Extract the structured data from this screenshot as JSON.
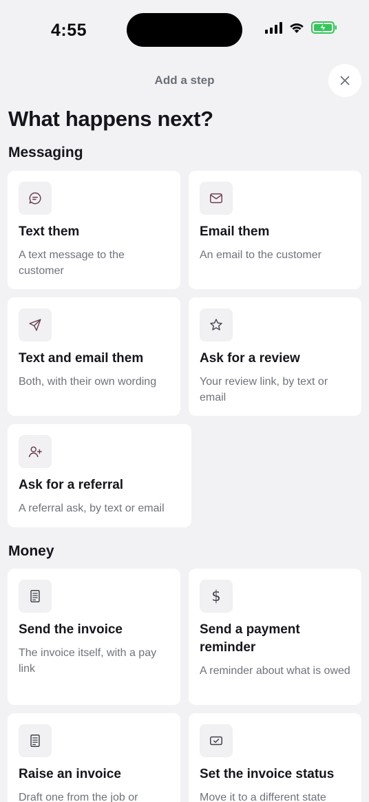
{
  "status_bar": {
    "time": "4:55"
  },
  "header": {
    "title": "Add a step"
  },
  "page": {
    "title": "What happens next?"
  },
  "sections": {
    "messaging": {
      "title": "Messaging",
      "cards": [
        {
          "title": "Text them",
          "description": "A text message to the customer",
          "icon": "chat-bubble-icon"
        },
        {
          "title": "Email them",
          "description": "An email to the customer",
          "icon": "envelope-icon"
        },
        {
          "title": "Text and email them",
          "description": "Both, with their own wording",
          "icon": "send-icon"
        },
        {
          "title": "Ask for a review",
          "description": "Your review link, by text or email",
          "icon": "star-icon"
        },
        {
          "title": "Ask for a referral",
          "description": "A referral ask, by text or email",
          "icon": "add-user-icon"
        }
      ]
    },
    "money": {
      "title": "Money",
      "cards": [
        {
          "title": "Send the invoice",
          "description": "The invoice itself, with a pay link",
          "icon": "receipt-icon"
        },
        {
          "title": "Send a payment reminder",
          "description": "A reminder about what is owed",
          "icon": "dollar-icon"
        },
        {
          "title": "Raise an invoice",
          "description": "Draft one from the job or",
          "icon": "receipt-icon"
        },
        {
          "title": "Set the invoice status",
          "description": "Move it to a different state",
          "icon": "check-ticket-icon"
        }
      ]
    }
  },
  "colors": {
    "background": "#f2f2f4",
    "card": "#ffffff",
    "icon_tint": "#6b3f4d",
    "muted_text": "#6e727b",
    "battery_green": "#34c759"
  }
}
